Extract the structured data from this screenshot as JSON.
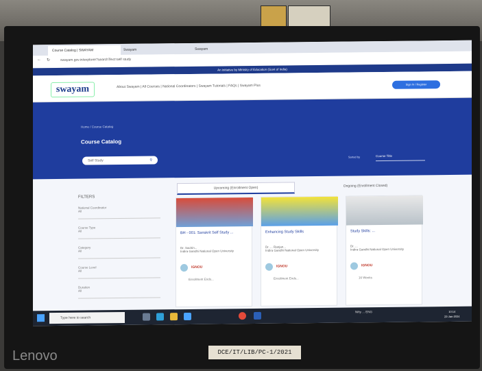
{
  "monitor": {
    "brand": "Lenovo",
    "asset_label": "DCE/IT/LIB/PC-1/2021"
  },
  "browser": {
    "tabs": [
      "Course Catalog | SWAYAM",
      "Swayam",
      "Swayam"
    ],
    "address": "swayam.gov.in/explorer?searchText=self study"
  },
  "site": {
    "ministry_banner": "An initiative by Ministry of Education (Govt of India)",
    "logo": "swayam",
    "nav": "About Swayam | All Courses | National Coordinators | Swayam Tutorials | FAQs | Swayam Plus",
    "signin": "Sign In / Register",
    "breadcrumb": "Home / Course Catalog",
    "title": "Course Catalog",
    "search_value": "Self Study",
    "sort_label": "Sorted by",
    "sort_value": "Course Title"
  },
  "filters": {
    "title": "FILTERS",
    "rows": [
      {
        "label": "National Coordinator",
        "value": "All"
      },
      {
        "label": "Course Type",
        "value": "All"
      },
      {
        "label": "Category",
        "value": "All"
      },
      {
        "label": "Course Level",
        "value": "All"
      },
      {
        "label": "Duration",
        "value": "All"
      }
    ]
  },
  "course_tabs": [
    "Upcoming (Enrollment Open)",
    "Ongoing (Enrollment Closed)"
  ],
  "cards": [
    {
      "title": "BH - 001: Sanskrit Self Study ...",
      "author": "Dr. Sachin...",
      "meta": "Indira Gandhi National Open University",
      "badge": "IGNOU",
      "dates": "Enrollment Ends..."
    },
    {
      "title": "Enhancing Study Skills",
      "author": "Dr. ... Ranjan...",
      "meta": "Indira Gandhi National Open University",
      "badge": "IGNOU",
      "dates": "Enrollment Ends..."
    },
    {
      "title": "Study Skills: ...",
      "author": "Dr. ...",
      "meta": "Indira Gandhi National Open University",
      "badge": "IGNOU",
      "dates": "16 Weeks"
    }
  ],
  "taskbar": {
    "search_placeholder": "Type here to search",
    "tray_text": "Nifty ... ENG",
    "time": "10:14",
    "date": "22-Jan-2024"
  },
  "colors": {
    "primary": "#1f3d9e",
    "accent": "#2d6fe0"
  }
}
